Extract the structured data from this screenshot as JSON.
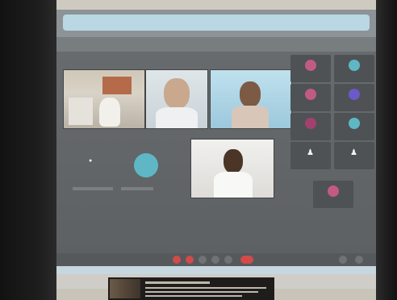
{
  "photo": {
    "subject": "",
    "caption_text": ""
  },
  "meeting": {
    "self_name": "",
    "participants": [
      {
        "name": ""
      },
      {
        "name": ""
      },
      {
        "name": ""
      },
      {
        "name": ""
      },
      {
        "name": ""
      },
      {
        "name": ""
      },
      {
        "name": ""
      },
      {
        "name": ""
      },
      {
        "name": ""
      },
      {
        "name": ""
      }
    ]
  },
  "colors": {
    "avatar_teal": "#5fb7c6",
    "avatar_pink": "#c25a86",
    "avatar_purple": "#6b5ac8",
    "control_red": "#d24a4a",
    "screen_bg": "#5a5e60"
  },
  "icons": [
    "record-icon",
    "mic-icon",
    "camera-icon",
    "present-icon",
    "hand-icon",
    "more-icon",
    "end-call-icon",
    "people-icon",
    "chat-icon"
  ]
}
